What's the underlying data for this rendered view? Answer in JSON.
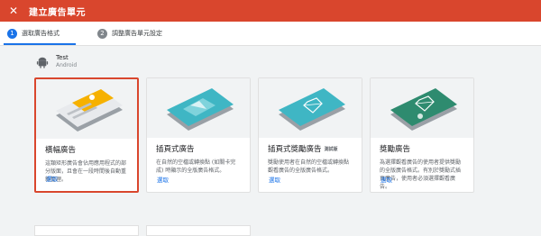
{
  "header": {
    "title": "建立廣告單元",
    "close_icon": "close-icon"
  },
  "stepper": {
    "steps": [
      {
        "number": "1",
        "label": "選取廣告格式"
      },
      {
        "number": "2",
        "label": "調整廣告單元設定"
      }
    ]
  },
  "app": {
    "name": "Test",
    "platform": "Android",
    "icon": "android-icon"
  },
  "formats": [
    {
      "title": "橫幅廣告",
      "badge": "",
      "description": "這類矩形廣告會佔用應用程式的部分版面，且會在一段時間後自動重新整理。",
      "action": "選取",
      "selected": true
    },
    {
      "title": "插頁式廣告",
      "badge": "",
      "description": "在自然的空檔或轉換點 (如關卡完成) 時顯示的全版廣告格式。",
      "action": "選取",
      "selected": false
    },
    {
      "title": "插頁式獎勵廣告",
      "badge": "測試版",
      "description": "獎勵使用者在自然的空檔或轉換點觀看廣告的全版廣告格式。",
      "action": "選取",
      "selected": false
    },
    {
      "title": "獎勵廣告",
      "badge": "",
      "description": "為選擇觀看廣告的使用者提供獎勵的全版廣告格式。有別於獎勵式插頁廣告，使用者必須選擇觀看廣告。",
      "action": "選取",
      "selected": false
    }
  ],
  "colors": {
    "header": "#d9462d",
    "primary": "#1a73e8",
    "banner_accent": "#f6b100",
    "interstitial": "#3fb6c4",
    "rewarded": "#2e8b6f"
  }
}
